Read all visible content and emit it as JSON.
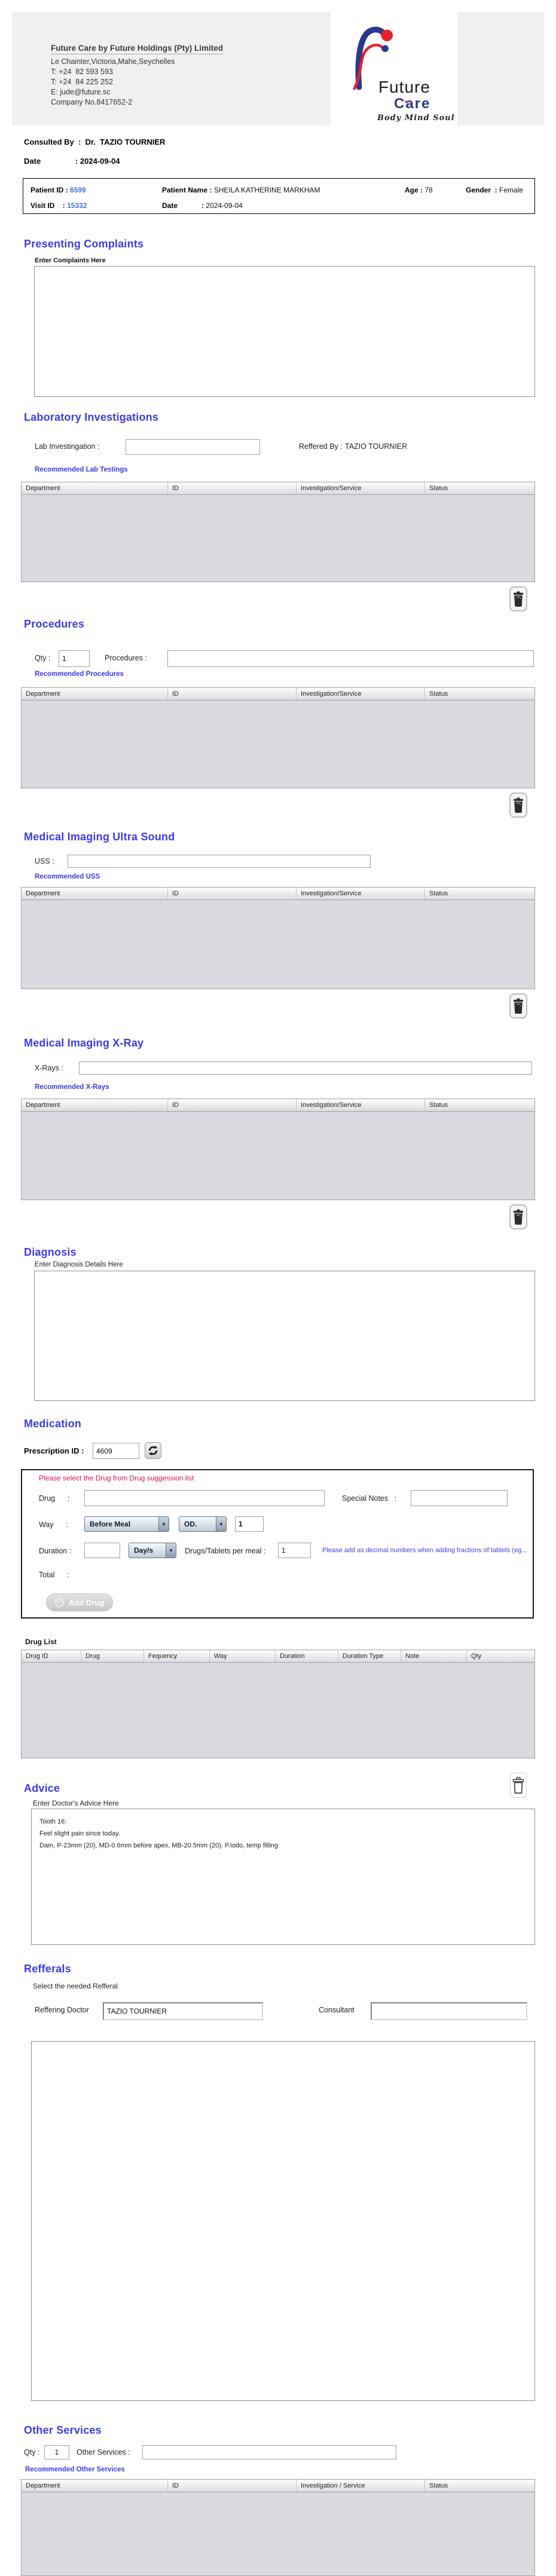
{
  "colors": {
    "section_heading_blue": "#3c3af2",
    "link_blue": "#3c3af2",
    "id_number_blue": "#4a6fd1",
    "alert_red": "#e3164e",
    "note_blue": "#3f3ff2",
    "logo_blue": "#2b3990",
    "logo_red": "#e8202e",
    "table_body_grey": "#d9dbe1"
  },
  "icons": {
    "dropdown_arrow": "▼",
    "add_plus": "+",
    "heart": "♥"
  },
  "header": {
    "company_title": "Future Care by Future Holdings (Pty) Limited",
    "address": "Le Chainter,Victoria,Mahe,Seychelles",
    "phone1": "T: +24  82 593 593",
    "phone2": "T: +24  84 225 252",
    "email": "E: jude@future.sc",
    "company_no": "Company No.8417652-2",
    "logo_word1": "Future",
    "logo_word2": "Care",
    "logo_tagline": "Body Mind Soul"
  },
  "consultation": {
    "consulted_by_label": "Consulted By  :",
    "consulted_by_value": "Dr.  TAZIO TOURNIER",
    "date_label": "Date                : ",
    "date_value": "2024-09-04"
  },
  "patient": {
    "id_label": "Patient ID : ",
    "id": "6599",
    "name_label": "Patient Name : ",
    "name": "SHEILA KATHERINE MARKHAM",
    "age_label": "Age : ",
    "age": "78",
    "gender_label": "Gender  : ",
    "gender": "Female",
    "visit_label": "Visit ID    : ",
    "visit": "15332",
    "date_label": "Date            : ",
    "date": "2024-09-04"
  },
  "complaints": {
    "title": "Presenting Complaints",
    "hint": "Enter Complaints Here",
    "value": ""
  },
  "laboratory": {
    "title": "Laboratory  Investigations",
    "field_label": "Lab Investingation :",
    "field_value": "",
    "referred_label": "Reffered By :",
    "referred_value": "TAZIO TOURNIER",
    "link": "Recommended Lab Testings",
    "headers": [
      "Department",
      "ID",
      "Investigation/Service",
      "Status"
    ]
  },
  "procedures": {
    "title": "Procedures",
    "qty_label": "Qty :",
    "qty_value": "1",
    "field_label": "Procedures :",
    "field_value": "",
    "link": "Recommended Procedures",
    "headers": [
      "Department",
      "ID",
      "Investigation/Service",
      "Status"
    ]
  },
  "ultrasound": {
    "title": "Medical Imaging Ultra Sound",
    "field_label": "USS :",
    "field_value": "",
    "link": "Recommended USS",
    "headers": [
      "Department",
      "ID",
      "Investigation/Service",
      "Status"
    ]
  },
  "xray": {
    "title": "Medical Imaging X-Ray",
    "field_label": "X-Rays :",
    "field_value": "",
    "link": "Recommended X-Rays",
    "headers": [
      "Department",
      "ID",
      "Investigation/Service",
      "Status"
    ]
  },
  "diagnosis": {
    "title": "Diagnosis",
    "hint": "Enter Diagnosis Details Here",
    "value": ""
  },
  "medication": {
    "title": "Medication",
    "prescription_label": "Prescription ID :",
    "prescription_id": "4609",
    "alert": "Please select the Drug from Drug suggession list",
    "drug_label": "Drug      :",
    "drug_value": "",
    "special_notes_label": "Special Notes   :",
    "special_notes_value": "",
    "way_label": "Way      :",
    "way_option": "Before Meal",
    "frequency_option": "OD.",
    "way_qty": "1",
    "duration_label": "Duration :",
    "duration_value": "",
    "duration_type_option": "Day/s",
    "per_meal_label": "Drugs/Tablets per meal :",
    "per_meal_value": "1",
    "note": "Please add as decimal numbers when adding fractions of tablets (eg...",
    "total_label": "Total      :",
    "add_button": "Add Drug",
    "drug_list_label": "Drug List",
    "drug_headers": [
      "Drug ID",
      "Drug",
      "Fequency",
      "Way",
      "Duration",
      "Duration Type",
      "Note",
      "Qty"
    ]
  },
  "advice": {
    "title": "Advice",
    "hint": "Enter Doctor's Advice Here",
    "value": "Tooth 16:\nFeel slight pain since today.\nDam, P-23mm (20), MD-0.6mm before apex, MB-20.5mm (20). P.Iodo, temp filling"
  },
  "referrals": {
    "title": "Refferals",
    "hint": "Select the needed Refferal",
    "doctor_label": "Reffering Doctor",
    "doctor_value": "TAZIO TOURNIER",
    "consultant_label": "Consultant",
    "consultant_value": ""
  },
  "other_services": {
    "title": "Other Services",
    "qty_label": "Qty :",
    "qty_value": "1",
    "field_label": "Other Services :",
    "field_value": "",
    "link": "Recommended Other Services",
    "headers": [
      "Department",
      "ID",
      "Investigation / Service",
      "Status"
    ]
  }
}
